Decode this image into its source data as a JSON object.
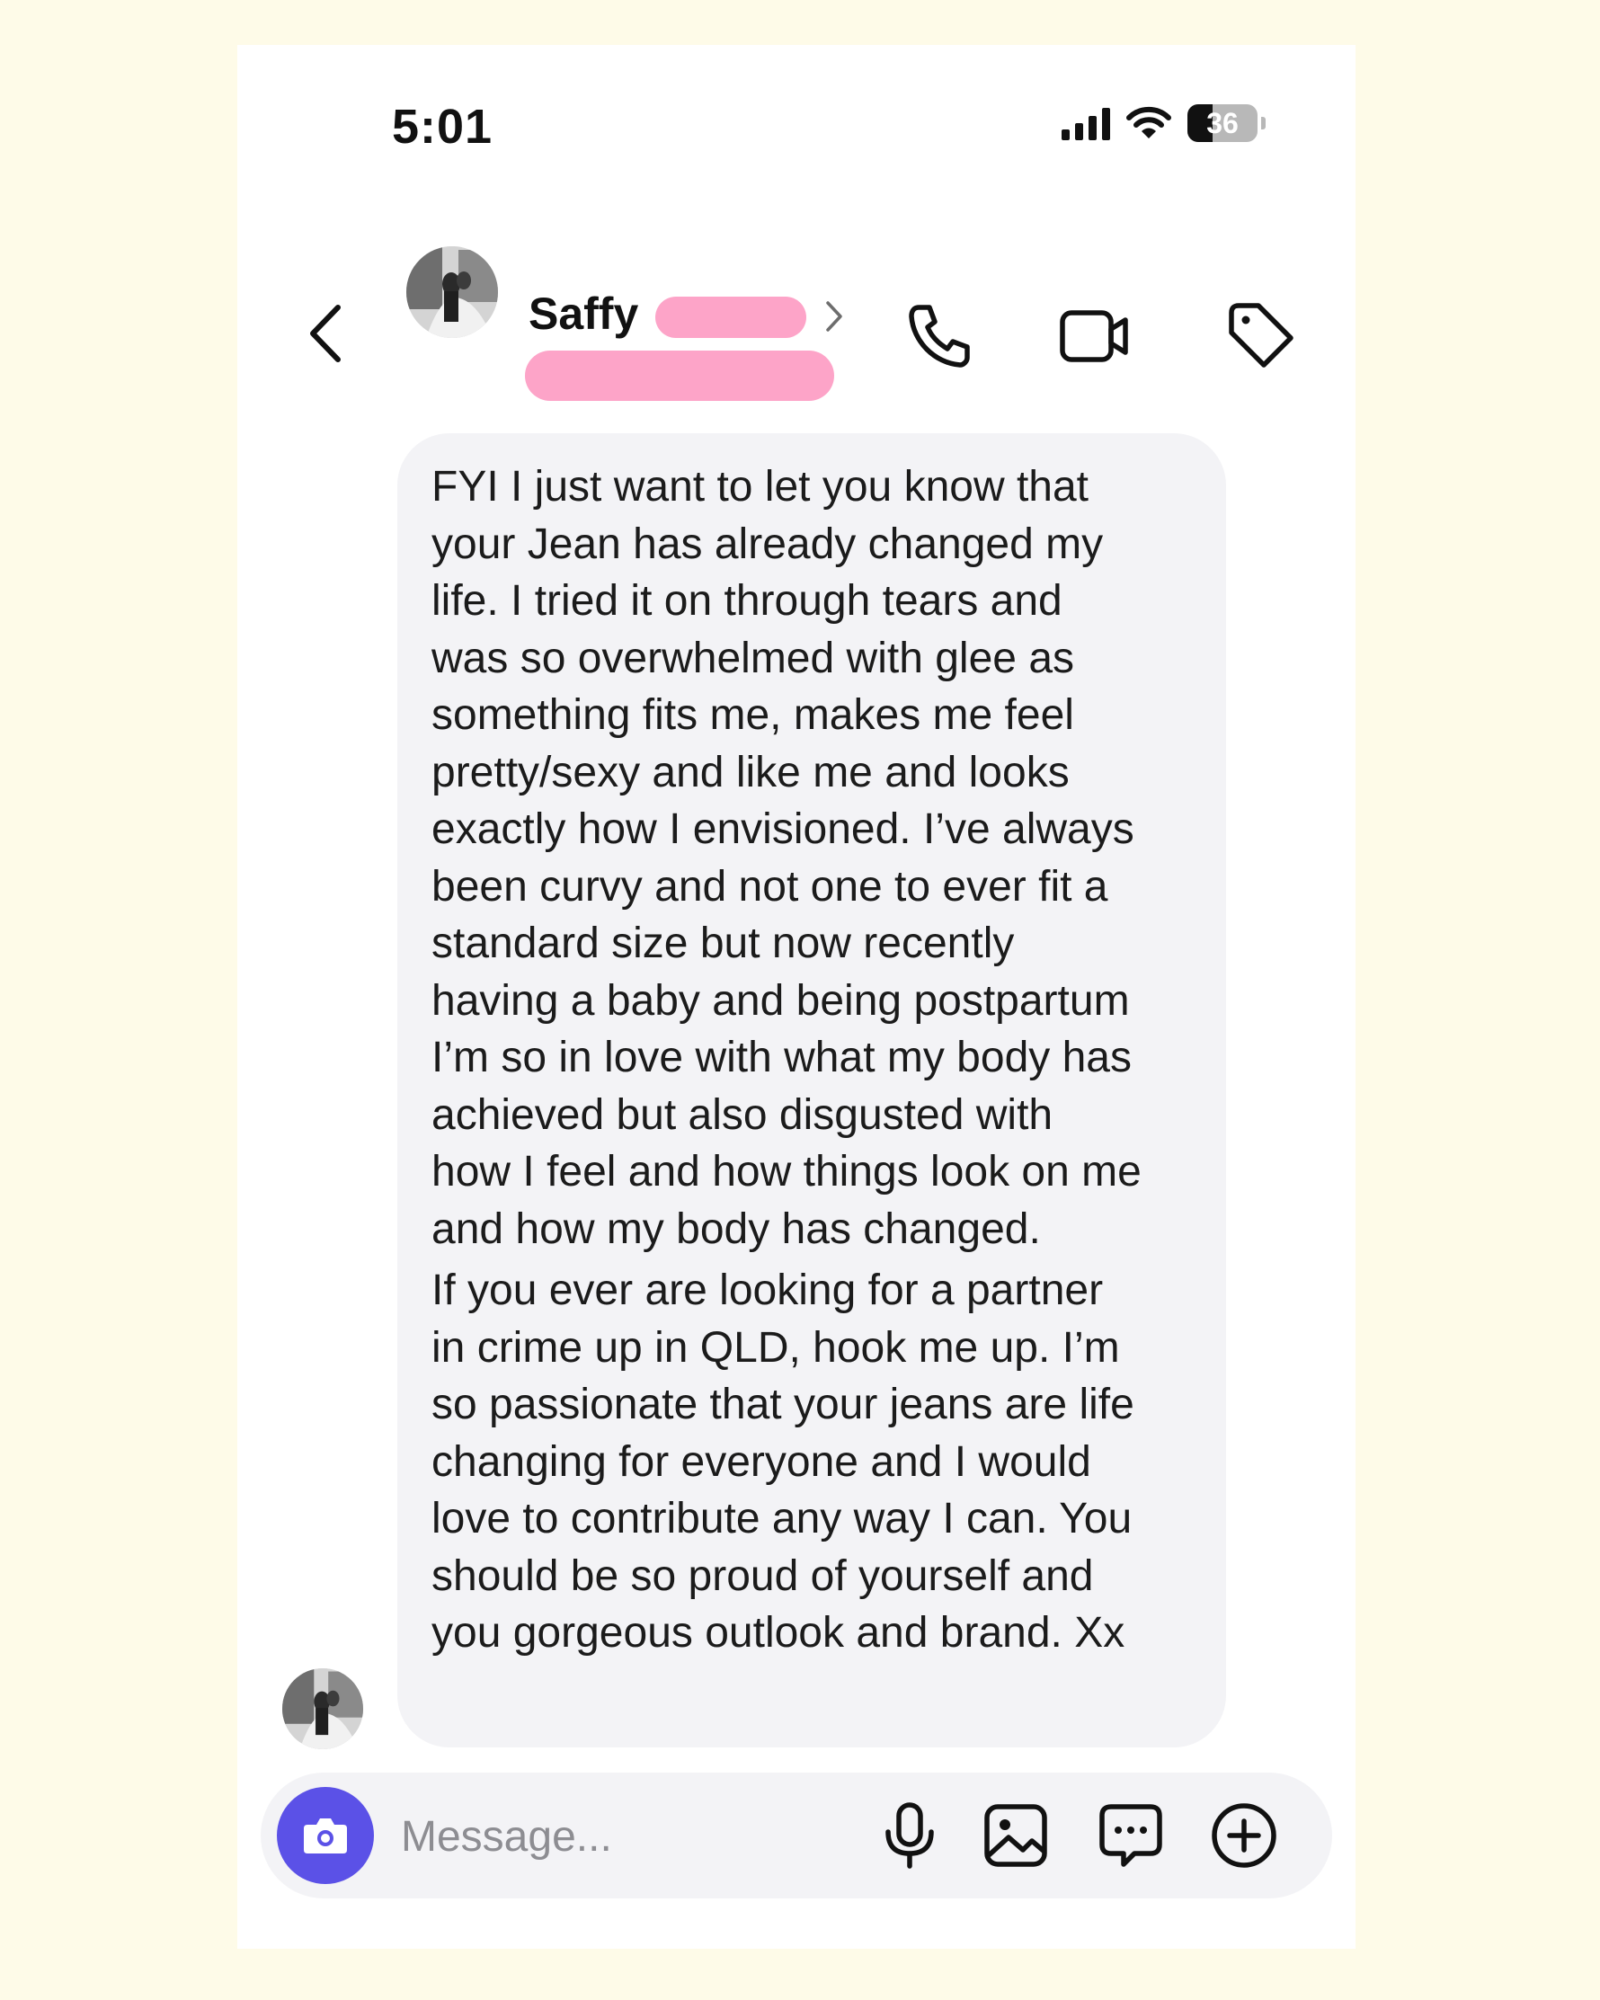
{
  "status_bar": {
    "time": "5:01",
    "battery_level": "36",
    "battery_fraction": 0.36
  },
  "header": {
    "contact_name": "Saffy",
    "back_icon": "chevron-left-icon",
    "action_icons": [
      "phone-icon",
      "video-icon",
      "tag-icon"
    ]
  },
  "message": {
    "paragraph_1": "FYI I just want to let you know that\nyour Jean has already changed my\nlife. I tried it on through tears and\nwas so overwhelmed with glee as\nsomething fits me, makes me feel\npretty/sexy and like me and looks\nexactly how I envisioned. I’ve always\nbeen curvy and not one to ever fit a\nstandard size but now recently\nhaving a baby and being postpartum\nI’m so in love with what my body has\nachieved but also disgusted with\nhow I feel and how things look on me\nand how my body has changed.",
    "paragraph_2": "If you ever are looking for a partner\nin crime up in QLD, hook me up. I’m\nso passionate that your jeans are life\nchanging for everyone and I would\nlove to contribute any way I can. You\nshould be so proud of yourself and\nyou gorgeous outlook and brand. Xx"
  },
  "composer": {
    "placeholder": "Message...",
    "icons": [
      "camera-icon",
      "microphone-icon",
      "gallery-icon",
      "sticker-icon",
      "plus-icon"
    ]
  },
  "colors": {
    "page_background": "#fefbe8",
    "bubble": "#f3f3f6",
    "camera_button": "#5b51e7",
    "redaction": "#fda4c8"
  }
}
